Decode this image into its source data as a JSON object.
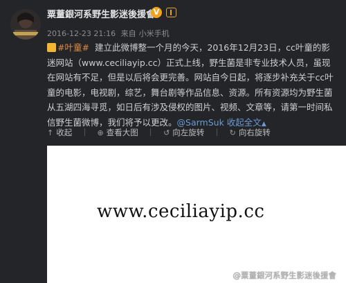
{
  "post": {
    "username": "粟蕫銀河系野生影迷後援會",
    "verified_badge": "V",
    "timestamp": "2016-12-23 21:16",
    "source_prefix": "来自",
    "source_device": "小米手机",
    "topic": "#叶童#",
    "body_main": "建立此微博整一个月的今天，2016年12月23日，cc叶童的影迷网站（www.ceciliayip.cc）正式上线，野生菌是非专业技术人员，虽现在网站有不足，但是以后将会更完善。网站自今日起，将逐步补充关于cc叶童的电影，电视剧，综艺，舞台剧等作品信息、资源。所有资源均为野生菌从五湖四海寻觅，如日后有涉及侵权的图片、视频、文章等，请第一时间私信野生菌微博，我们将予以更改。",
    "mention": "@SarmSuk",
    "fold_label": "收起全文"
  },
  "toolbar": {
    "collapse_label": "收起",
    "view_large_label": "查看大图",
    "rotate_left_label": "向左旋转",
    "rotate_right_label": "向右旋转"
  },
  "image": {
    "url_text": "www.ceciliayip.cc",
    "watermark": "@粟蕫銀河系野生影迷後援會"
  },
  "colors": {
    "background": "#232528",
    "link": "#6b9ad4",
    "topic": "#e08a3e",
    "verified": "#f3a21c"
  }
}
